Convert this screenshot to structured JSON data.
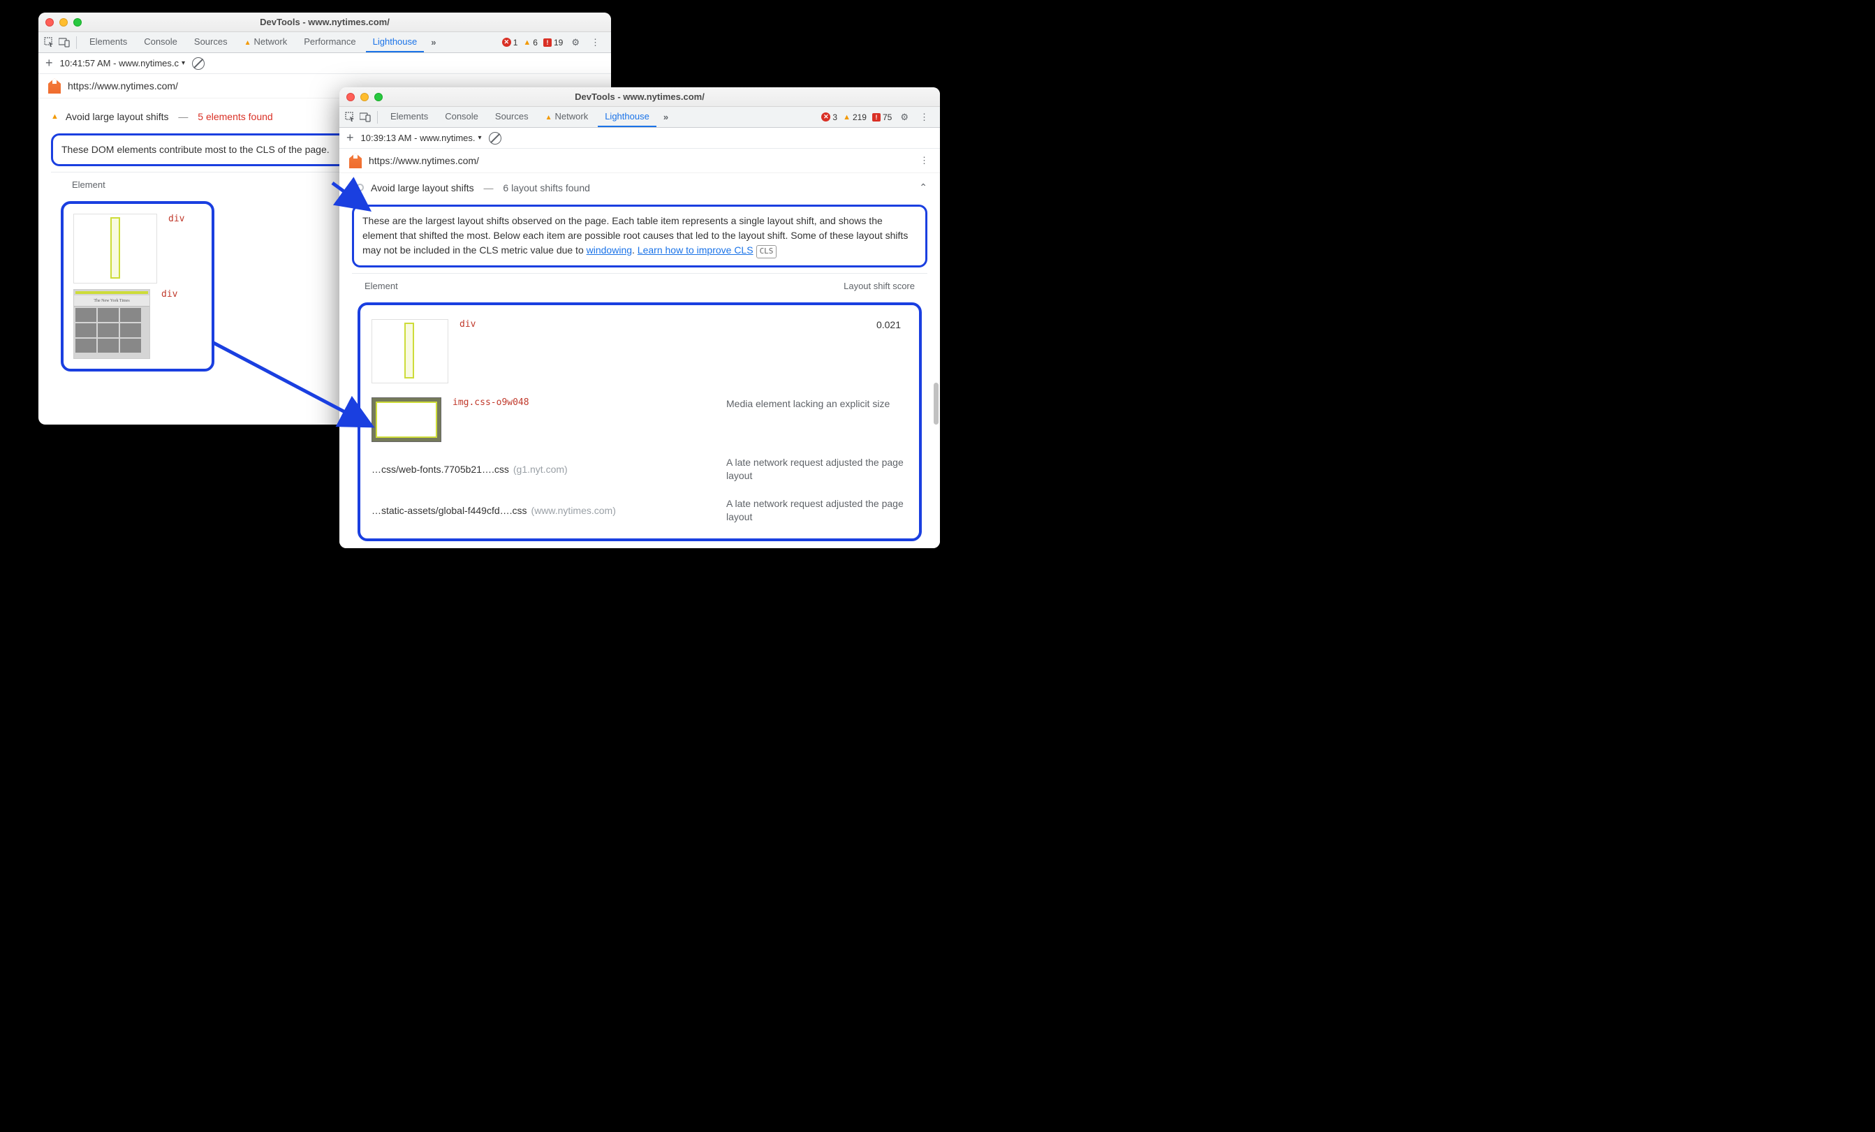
{
  "windows": {
    "left": {
      "title": "DevTools - www.nytimes.com/",
      "tabs": [
        "Elements",
        "Console",
        "Sources",
        "Network",
        "Performance",
        "Lighthouse"
      ],
      "activeTab": "Lighthouse",
      "status": {
        "errors": 1,
        "warnings": 6,
        "violations": 19
      },
      "timestampDropdown": "10:41:57 AM - www.nytimes.c",
      "url": "https://www.nytimes.com/",
      "audit": {
        "title": "Avoid large layout shifts",
        "countText": "5 elements found"
      },
      "description": "These DOM elements contribute most to the CLS of the page.",
      "tableHeader": "Element",
      "elements": [
        {
          "tag": "div"
        },
        {
          "tag": "div"
        }
      ]
    },
    "right": {
      "title": "DevTools - www.nytimes.com/",
      "tabs": [
        "Elements",
        "Console",
        "Sources",
        "Network",
        "Lighthouse"
      ],
      "activeTab": "Lighthouse",
      "status": {
        "errors": 3,
        "warnings": 219,
        "violations": 75
      },
      "timestampDropdown": "10:39:13 AM - www.nytimes.",
      "url": "https://www.nytimes.com/",
      "audit": {
        "title": "Avoid large layout shifts",
        "countText": "6 layout shifts found"
      },
      "descriptionParts": {
        "p1": "These are the largest layout shifts observed on the page. Each table item represents a single layout shift, and shows the element that shifted the most. Below each item are possible root causes that led to the layout shift. Some of these layout shifts may not be included in the CLS metric value due to ",
        "link1": "windowing",
        "sep": ". ",
        "link2": "Learn how to improve CLS",
        "badge": "CLS"
      },
      "tableHeaders": {
        "left": "Element",
        "right": "Layout shift score"
      },
      "mainElement": {
        "tag": "div",
        "score": "0.021"
      },
      "causes": [
        {
          "tag": "img.css-o9w048",
          "reason": "Media element lacking an explicit size"
        },
        {
          "file": "…css/web-fonts.7705b21….css",
          "host": "(g1.nyt.com)",
          "reason": "A late network request adjusted the page layout"
        },
        {
          "file": "…static-assets/global-f449cfd….css",
          "host": "(www.nytimes.com)",
          "reason": "A late network request adjusted the page layout"
        }
      ]
    }
  },
  "icons": {
    "warnTriangle": "▲",
    "overflow": "»",
    "gear": "⚙",
    "kebab": "⋮",
    "plus": "+"
  }
}
